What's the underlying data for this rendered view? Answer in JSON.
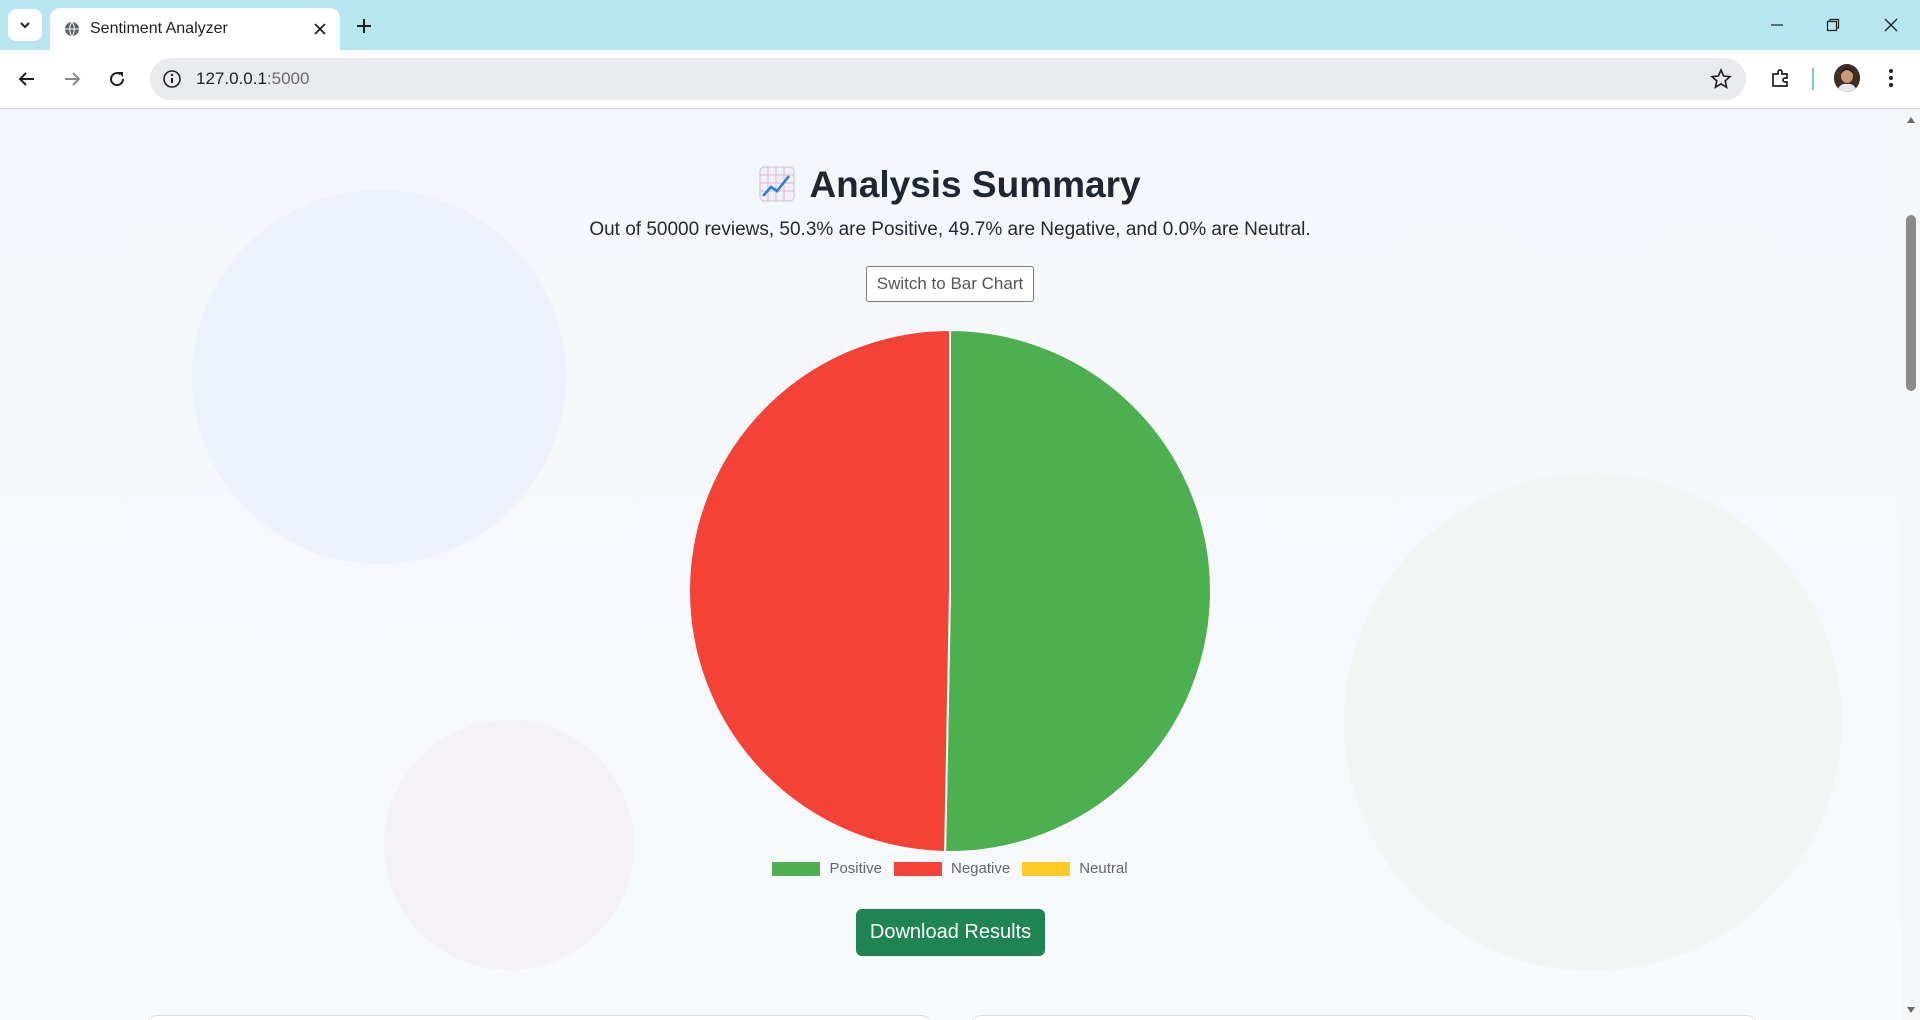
{
  "browser": {
    "tab_title": "Sentiment Analyzer",
    "url_host": "127.0.0.1",
    "url_port": ":5000"
  },
  "page": {
    "heading": "Analysis Summary",
    "summary": "Out of 50000 reviews, 50.3% are Positive, 49.7% are Negative, and 0.0% are Neutral.",
    "switch_button": "Switch to Bar Chart",
    "download_button": "Download Results"
  },
  "chart_data": {
    "type": "pie",
    "categories": [
      "Positive",
      "Negative",
      "Neutral"
    ],
    "values": [
      50.3,
      49.7,
      0.0
    ],
    "colors": [
      "#4caf50",
      "#f44336",
      "#ffca28"
    ],
    "legend_position": "bottom"
  }
}
